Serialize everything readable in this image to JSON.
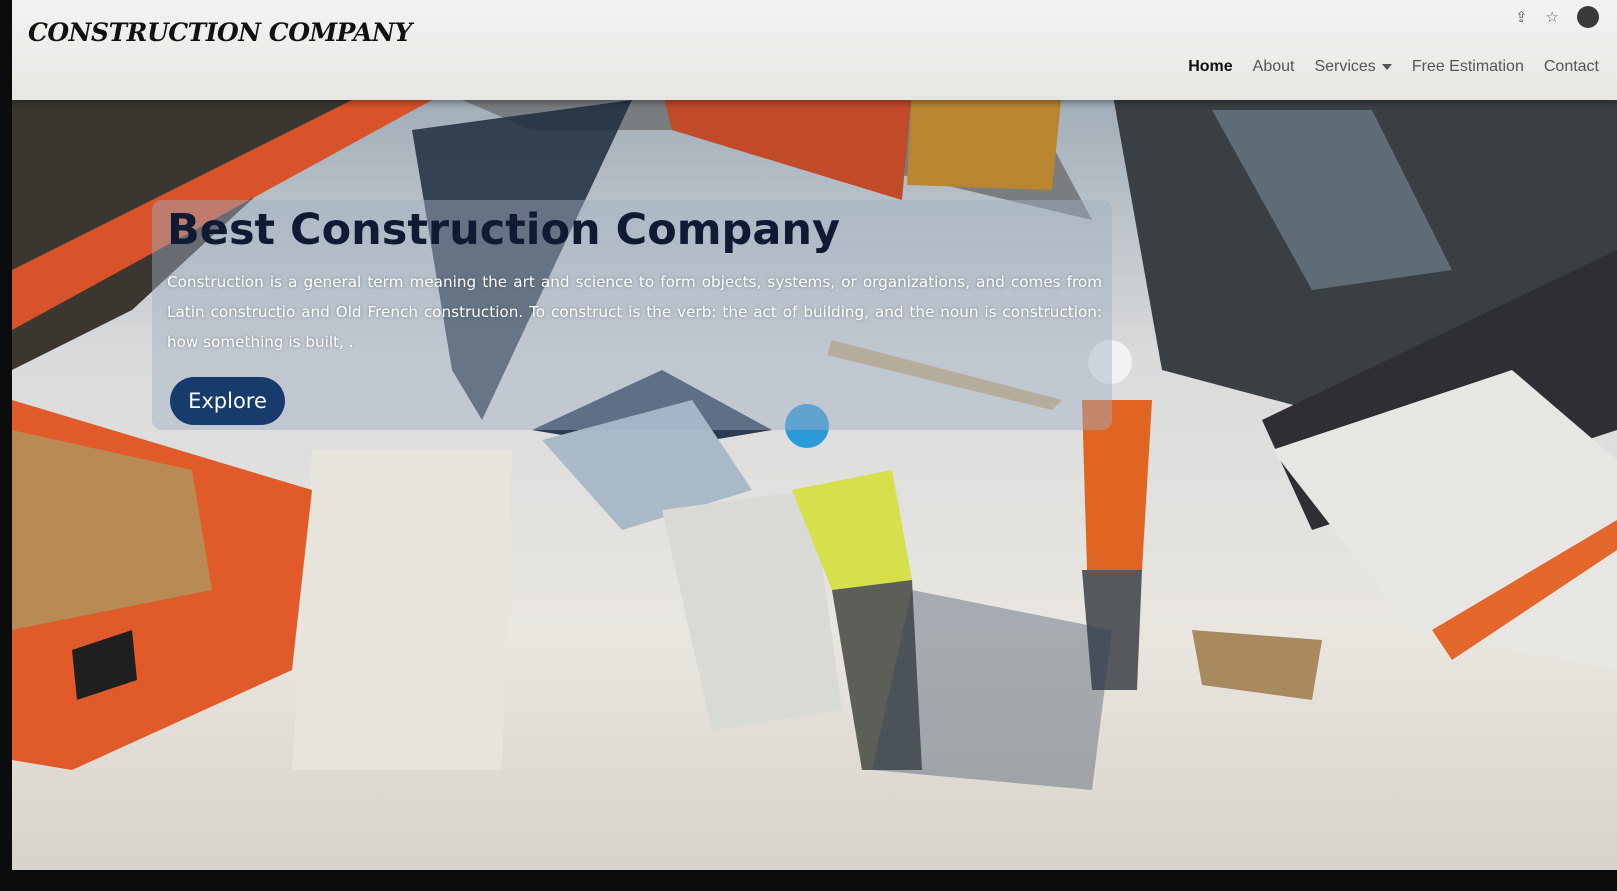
{
  "navbar": {
    "brand": "CONSTRUCTION COMPANY",
    "links": {
      "home": "Home",
      "about": "About",
      "services": "Services",
      "free_estimation": "Free Estimation",
      "contact": "Contact"
    }
  },
  "browser_icons": [
    "share-icon",
    "star-icon",
    "profile-avatar"
  ],
  "hero": {
    "title": "Best Construction Company",
    "description": "Construction is a general term meaning the art and science to form objects, systems, or organizations, and comes from Latin constructio and Old French construction. To construct is the verb: the act of building, and the noun is construction: how something is built, .",
    "button": "Explore"
  },
  "colors": {
    "button_bg": "#173b6c",
    "title": "#0f1b33"
  }
}
